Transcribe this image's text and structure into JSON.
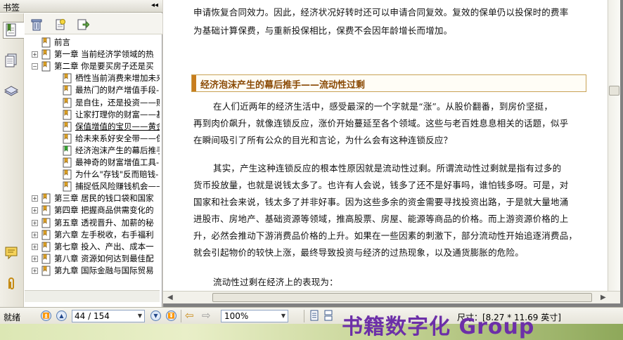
{
  "left_panel": {
    "title": "书签",
    "collapse_glyph": "◂◂",
    "side_tabs": [
      "bookmarks-icon",
      "pages-icon",
      "layers-icon",
      "comments-icon",
      "attachments-icon"
    ],
    "toolbar": [
      "delete-icon",
      "new-bookmark-icon",
      "goto-bookmark-icon"
    ]
  },
  "tree": [
    {
      "label": "前言",
      "level": 0,
      "expander": ""
    },
    {
      "label": "第一章 当前经济学领域的热",
      "level": 0,
      "expander": "+"
    },
    {
      "label": "第二章 你是要买房子还是买",
      "level": 0,
      "expander": "−"
    },
    {
      "label": "栖性当前消费来增加未来",
      "level": 1,
      "expander": ""
    },
    {
      "label": "最热门的财产增值手段-",
      "level": 1,
      "expander": ""
    },
    {
      "label": "是自住，还是投资——购",
      "level": 1,
      "expander": ""
    },
    {
      "label": "让家打理你的财富——基",
      "level": 1,
      "expander": ""
    },
    {
      "label": "保值增值的宝贝——黄金",
      "level": 1,
      "expander": ""
    },
    {
      "label": "给未来系好安全带——保",
      "level": 1,
      "expander": ""
    },
    {
      "label": "经济泡沫产生的幕后推手",
      "level": 1,
      "expander": "",
      "current": true
    },
    {
      "label": "最神奇的财富增值工具-",
      "level": 1,
      "expander": ""
    },
    {
      "label": "为什么\"存钱\"反而赔钱-",
      "level": 1,
      "expander": ""
    },
    {
      "label": "捕捉低风险赚钱机会——",
      "level": 1,
      "expander": ""
    },
    {
      "label": "第三章 居民的钱口袋和国家",
      "level": 0,
      "expander": "+"
    },
    {
      "label": "第四章 把握商品供需变化的",
      "level": 0,
      "expander": "+"
    },
    {
      "label": "第五章 透视晋升、加薪的秘",
      "level": 0,
      "expander": "+"
    },
    {
      "label": "第六章 左手税收，右手福利",
      "level": 0,
      "expander": "+"
    },
    {
      "label": "第七章 投入、产出、成本一",
      "level": 0,
      "expander": "+"
    },
    {
      "label": "第八章 资源如何达到最佳配",
      "level": 0,
      "expander": "+"
    },
    {
      "label": "第九章 国际金融与国际贸易",
      "level": 0,
      "expander": "+"
    }
  ],
  "document": {
    "p1_line1": "申请恢复合同效力。因此，经济状况好转时还可以申请合同复效。复效的保单仍以投保时的费率",
    "p1_line2": "为基础计算保费，与重新投保相比，保费不会因年龄增长而增加。",
    "heading": "经济泡沫产生的幕后推手——流动性过剩",
    "p2": [
      "在人们近两年的经济生活中，感受最深的一个字就是“涨”。从股价翻番，到房价坚挺，",
      "再到肉价飙升，就像连锁反应，涨价开始蔓延至各个领域。这些与老百姓息息相关的话题，似乎",
      "在瞬间吸引了所有公众的目光和言论，为什么会有这种连锁反应？"
    ],
    "p3": [
      "其实，产生这种连锁反应的根本性原因就是流动性过剩。所谓流动性过剩就是指有过多的",
      "货币投放量，也就是说钱太多了。也许有人会说，钱多了还不是好事吗，谁怕钱多呀。可是，对",
      "国家和社会来说，钱太多了并非好事。因为这些多余的资金需要寻找投资出路，于是就大量地涌",
      "进股市、房地产、基础资源等领域，推高股票、房屋、能源等商品的价格。而上游资源价格的上",
      "升，必然会推动下游消费品价格的上升。如果在一些因素的刺激下，部分流动性开始追逐消费品，",
      "就会引起物价的较快上涨，最终导致投资与经济的过热现象，以及通货膨胀的危险。"
    ],
    "p4": "流动性过剩在经济上的表现为："
  },
  "status_bar": {
    "state": "就绪",
    "page": "44 / 154",
    "zoom": "100%",
    "page_size": "尺寸：[8.27 * 11.69 英寸]"
  },
  "watermark": "书籍数字化 Group",
  "colors": {
    "heading_text": "#8a4a05",
    "heading_bar": "#c87d1c",
    "watermark": "#6c2fa8"
  }
}
